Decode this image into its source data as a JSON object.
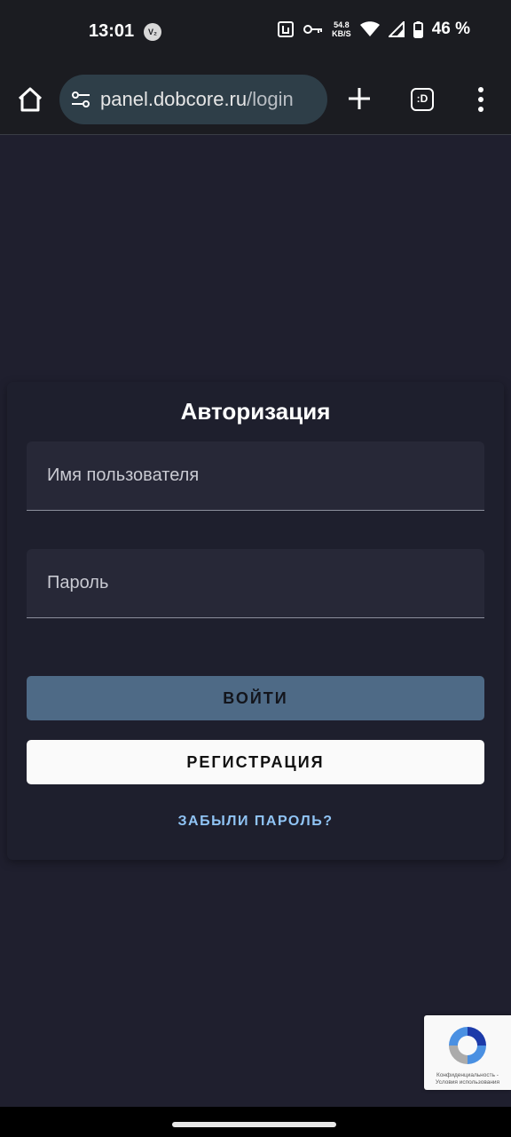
{
  "status_bar": {
    "time": "13:01",
    "vpn_badge": "V₂",
    "net_speed_value": "54.8",
    "net_speed_unit": "KB/S",
    "battery_percent": "46 %",
    "icons": [
      "nfc-icon",
      "vpn-key-icon",
      "wifi-icon",
      "signal-icon",
      "battery-icon"
    ]
  },
  "browser": {
    "url_host": "panel.dobcore.ru",
    "url_path": "/login",
    "tabs_label": ":D",
    "icons": [
      "home-icon",
      "site-settings-icon",
      "plus-icon",
      "tab-switcher-icon",
      "more-vert-icon"
    ]
  },
  "login_form": {
    "title": "Авторизация",
    "username_placeholder": "Имя пользователя",
    "password_placeholder": "Пароль",
    "login_button": "ВОЙТИ",
    "register_button": "РЕГИСТРАЦИЯ",
    "forgot_password": "ЗАБЫЛИ ПАРОЛЬ?"
  },
  "recaptcha": {
    "privacy": "Конфиденциальность",
    "separator": " - ",
    "terms": "Условия использования"
  },
  "colors": {
    "page_bg": "#1f1f2e",
    "field_bg": "#272837",
    "login_button_bg": "#4e6a86",
    "register_button_bg": "#fafafa",
    "link": "#90c4f5"
  }
}
